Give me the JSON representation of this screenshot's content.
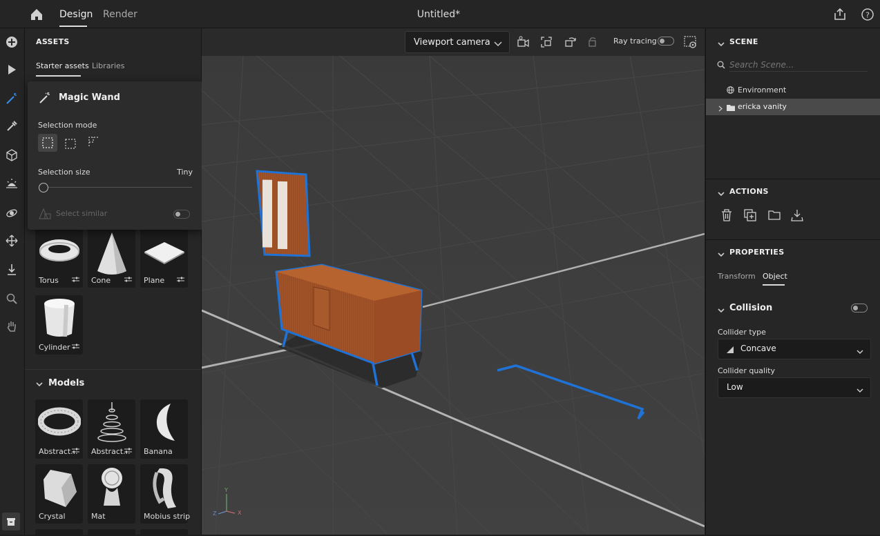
{
  "topbar": {
    "tabs": [
      "Design",
      "Render"
    ],
    "title": "Untitled*"
  },
  "assets": {
    "heading": "ASSETS",
    "tabs": [
      "Starter assets",
      "Libraries"
    ],
    "shapes": [
      {
        "label": "Torus"
      },
      {
        "label": "Cone"
      },
      {
        "label": "Plane"
      },
      {
        "label": "Cylinder"
      }
    ],
    "models_heading": "Models",
    "models": [
      {
        "label": "Abstract..."
      },
      {
        "label": "Abstract..."
      },
      {
        "label": "Banana"
      },
      {
        "label": "Crystal"
      },
      {
        "label": "Mat"
      },
      {
        "label": "Mobius strip"
      }
    ]
  },
  "wand": {
    "title": "Magic Wand",
    "mode_label": "Selection mode",
    "size_label": "Selection size",
    "size_value": "Tiny",
    "similar_label": "Select similar"
  },
  "viewport": {
    "camera": "Viewport camera",
    "ray_label": "Ray tracing"
  },
  "scene": {
    "heading": "SCENE",
    "search_placeholder": "Search Scene...",
    "items": [
      "Environment",
      "ericka vanity"
    ]
  },
  "actions": {
    "heading": "ACTIONS"
  },
  "properties": {
    "heading": "PROPERTIES",
    "tabs": [
      "Transform",
      "Object"
    ],
    "collision": "Collision",
    "collider_type_label": "Collider type",
    "collider_type_value": "Concave",
    "collider_quality_label": "Collider quality",
    "collider_quality_value": "Low"
  },
  "colors": {
    "accent": "#378ef0",
    "selection": "#1f73d6",
    "wood": "#a8582c"
  }
}
